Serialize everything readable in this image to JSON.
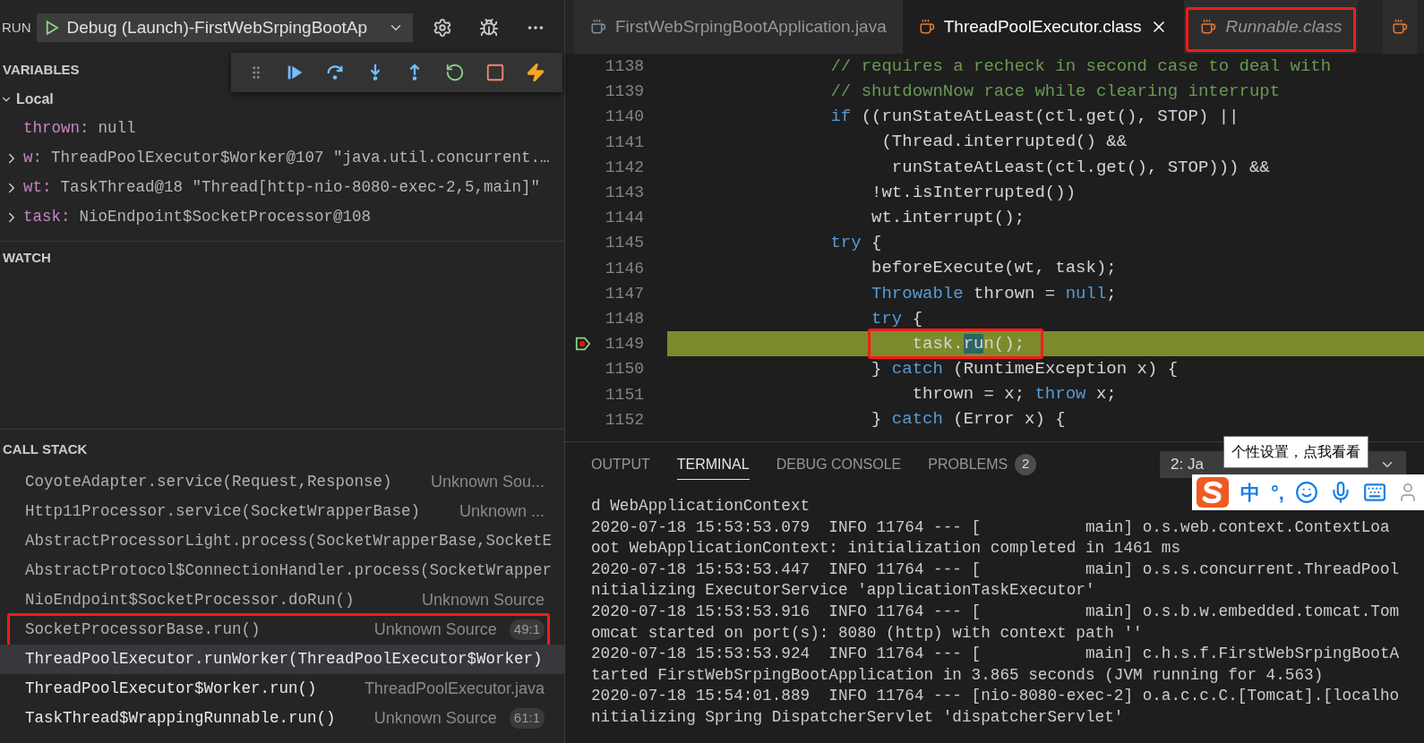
{
  "run_bar": {
    "label": "RUN",
    "config": "Debug (Launch)-FirstWebSrpingBootAp"
  },
  "variables": {
    "title": "VARIABLES",
    "scope": {
      "label": "Local",
      "expanded": true
    },
    "items": [
      {
        "name": "thrown:",
        "value": "null",
        "expandable": false
      },
      {
        "name": "w:",
        "value": "ThreadPoolExecutor$Worker@107 \"java.util.concurrent.…",
        "expandable": true
      },
      {
        "name": "wt:",
        "value": "TaskThread@18 \"Thread[http-nio-8080-exec-2,5,main]\"",
        "expandable": true
      },
      {
        "name": "task:",
        "value": "NioEndpoint$SocketProcessor@108",
        "expandable": true
      }
    ]
  },
  "watch": {
    "title": "WATCH"
  },
  "call_stack": {
    "title": "CALL STACK",
    "frames": [
      {
        "name": "CoyoteAdapter.service(Request,Response)",
        "source": "Unknown Sou...",
        "selected": false,
        "dimmed": true,
        "annotated": false
      },
      {
        "name": "Http11Processor.service(SocketWrapperBase)",
        "source": "Unknown ...",
        "selected": false,
        "dimmed": true,
        "annotated": false
      },
      {
        "name": "AbstractProcessorLight.process(SocketWrapperBase,SocketE",
        "selected": false,
        "dimmed": true,
        "annotated": false
      },
      {
        "name": "AbstractProtocol$ConnectionHandler.process(SocketWrapper",
        "selected": false,
        "dimmed": true,
        "annotated": false
      },
      {
        "name": "NioEndpoint$SocketProcessor.doRun()",
        "source": "Unknown Source",
        "selected": false,
        "dimmed": true,
        "annotated": false
      },
      {
        "name": "SocketProcessorBase.run()",
        "source": "Unknown Source",
        "badge": "49:1",
        "selected": false,
        "dimmed": true,
        "annotated": true
      },
      {
        "name": "ThreadPoolExecutor.runWorker(ThreadPoolExecutor$Worker)",
        "selected": true,
        "dimmed": false,
        "annotated": false
      },
      {
        "name": "ThreadPoolExecutor$Worker.run()",
        "source": "ThreadPoolExecutor.java",
        "selected": false,
        "dimmed": false,
        "annotated": false
      },
      {
        "name": "TaskThread$WrappingRunnable.run()",
        "source": "Unknown Source",
        "badge": "61:1",
        "selected": false,
        "dimmed": false,
        "annotated": false
      }
    ]
  },
  "editor": {
    "tabs": [
      {
        "label": "FirstWebSrpingBootApplication.java",
        "selected": false,
        "preview": false,
        "closable": false,
        "annotated": false
      },
      {
        "label": "ThreadPoolExecutor.class",
        "selected": true,
        "preview": false,
        "closable": true,
        "annotated": false
      },
      {
        "label": "Runnable.class",
        "selected": false,
        "preview": true,
        "closable": false,
        "annotated": true
      }
    ],
    "lines": [
      {
        "number": "1138",
        "current": false,
        "annotated": false,
        "tokens": [
          {
            "kind": "comment",
            "text": "                // requires a recheck in second case to deal with"
          }
        ]
      },
      {
        "number": "1139",
        "current": false,
        "annotated": false,
        "tokens": [
          {
            "kind": "comment",
            "text": "                // shutdownNow race while clearing interrupt"
          }
        ]
      },
      {
        "number": "1140",
        "current": false,
        "annotated": false,
        "tokens": [
          {
            "kind": "keyword",
            "text": "                if"
          },
          {
            "kind": "plain",
            "text": " ((runStateAtLeast(ctl.get(), STOP) ||"
          }
        ]
      },
      {
        "number": "1141",
        "current": false,
        "annotated": false,
        "tokens": [
          {
            "kind": "plain",
            "text": "                     (Thread.interrupted() &&"
          }
        ]
      },
      {
        "number": "1142",
        "current": false,
        "annotated": false,
        "tokens": [
          {
            "kind": "plain",
            "text": "                      runStateAtLeast(ctl.get(), STOP))) &&"
          }
        ]
      },
      {
        "number": "1143",
        "current": false,
        "annotated": false,
        "tokens": [
          {
            "kind": "plain",
            "text": "                    !wt.isInterrupted())"
          }
        ]
      },
      {
        "number": "1144",
        "current": false,
        "annotated": false,
        "tokens": [
          {
            "kind": "plain",
            "text": "                    wt.interrupt();"
          }
        ]
      },
      {
        "number": "1145",
        "current": false,
        "annotated": false,
        "tokens": [
          {
            "kind": "keyword",
            "text": "                try"
          },
          {
            "kind": "plain",
            "text": " {"
          }
        ]
      },
      {
        "number": "1146",
        "current": false,
        "annotated": false,
        "tokens": [
          {
            "kind": "plain",
            "text": "                    beforeExecute(wt, task);"
          }
        ]
      },
      {
        "number": "1147",
        "current": false,
        "annotated": false,
        "tokens": [
          {
            "kind": "keyword",
            "text": "                    Throwable"
          },
          {
            "kind": "plain",
            "text": " thrown = "
          },
          {
            "kind": "keyword",
            "text": "null"
          },
          {
            "kind": "plain",
            "text": ";"
          }
        ]
      },
      {
        "number": "1148",
        "current": false,
        "annotated": false,
        "tokens": [
          {
            "kind": "keyword",
            "text": "                    try"
          },
          {
            "kind": "plain",
            "text": " {"
          }
        ]
      },
      {
        "number": "1149",
        "current": true,
        "annotated": true,
        "tokens": [
          {
            "kind": "plain",
            "text": "                        task."
          },
          {
            "kind": "selection",
            "text": "ru"
          },
          {
            "kind": "plain",
            "text": "n();"
          }
        ]
      },
      {
        "number": "1150",
        "current": false,
        "annotated": false,
        "tokens": [
          {
            "kind": "plain",
            "text": "                    } "
          },
          {
            "kind": "keyword",
            "text": "catch"
          },
          {
            "kind": "plain",
            "text": " (RuntimeException x) {"
          }
        ]
      },
      {
        "number": "1151",
        "current": false,
        "annotated": false,
        "tokens": [
          {
            "kind": "plain",
            "text": "                        thrown = x; "
          },
          {
            "kind": "keyword",
            "text": "throw"
          },
          {
            "kind": "plain",
            "text": " x;"
          }
        ]
      },
      {
        "number": "1152",
        "current": false,
        "annotated": false,
        "tokens": [
          {
            "kind": "plain",
            "text": "                    } "
          },
          {
            "kind": "keyword",
            "text": "catch"
          },
          {
            "kind": "plain",
            "text": " (Error x) {"
          }
        ]
      }
    ]
  },
  "panel": {
    "tabs": [
      {
        "label": "OUTPUT",
        "selected": false
      },
      {
        "label": "TERMINAL",
        "selected": true
      },
      {
        "label": "DEBUG CONSOLE",
        "selected": false
      },
      {
        "label": "PROBLEMS",
        "selected": false,
        "badge": "2"
      }
    ],
    "terminal_select": "2: Ja",
    "tooltip": "个性设置，点我看看",
    "ime": {
      "mode": "中",
      "punctuation": "°,"
    },
    "terminal_lines": [
      "d WebApplicationContext",
      "2020-07-18 15:53:53.079  INFO 11764 --- [           main] o.s.web.context.ContextLoa",
      "oot WebApplicationContext: initialization completed in 1461 ms",
      "2020-07-18 15:53:53.447  INFO 11764 --- [           main] o.s.s.concurrent.ThreadPool",
      "nitializing ExecutorService 'applicationTaskExecutor'",
      "2020-07-18 15:53:53.916  INFO 11764 --- [           main] o.s.b.w.embedded.tomcat.Tom",
      "omcat started on port(s): 8080 (http) with context path ''",
      "2020-07-18 15:53:53.924  INFO 11764 --- [           main] c.h.s.f.FirstWebSrpingBootA",
      "tarted FirstWebSrpingBootApplication in 3.865 seconds (JVM running for 4.563)",
      "2020-07-18 15:54:01.889  INFO 11764 --- [nio-8080-exec-2] o.a.c.c.C.[Tomcat].[localho",
      "nitializing Spring DispatcherServlet 'dispatcherServlet'"
    ]
  }
}
